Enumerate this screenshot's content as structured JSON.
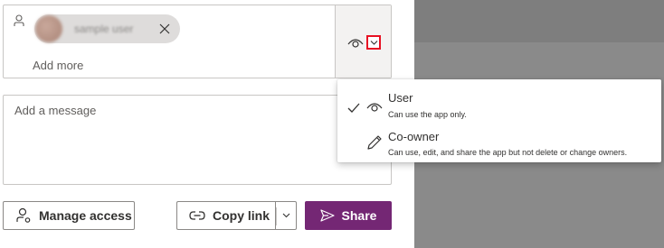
{
  "recipients": {
    "chip": {
      "name": "sample user",
      "remove_icon": "close-icon"
    },
    "add_more_placeholder": "Add more",
    "icons": {
      "person": "person-icon",
      "permission": "eye-icon",
      "dropdown": "chevron-down-icon"
    }
  },
  "message": {
    "placeholder": "Add a message"
  },
  "buttons": {
    "manage_access": "Manage access",
    "copy_link": "Copy link",
    "share": "Share"
  },
  "permission_menu": {
    "items": [
      {
        "title": "User",
        "description": "Can use the app only.",
        "icon": "eye-icon",
        "selected": true
      },
      {
        "title": "Co-owner",
        "description": "Can use, edit, and share the app but not delete or change owners.",
        "icon": "pencil-icon",
        "selected": false
      }
    ]
  },
  "colors": {
    "share_button": "#742774",
    "highlight_border": "#e81123",
    "overlay": "#8a8a8a"
  }
}
